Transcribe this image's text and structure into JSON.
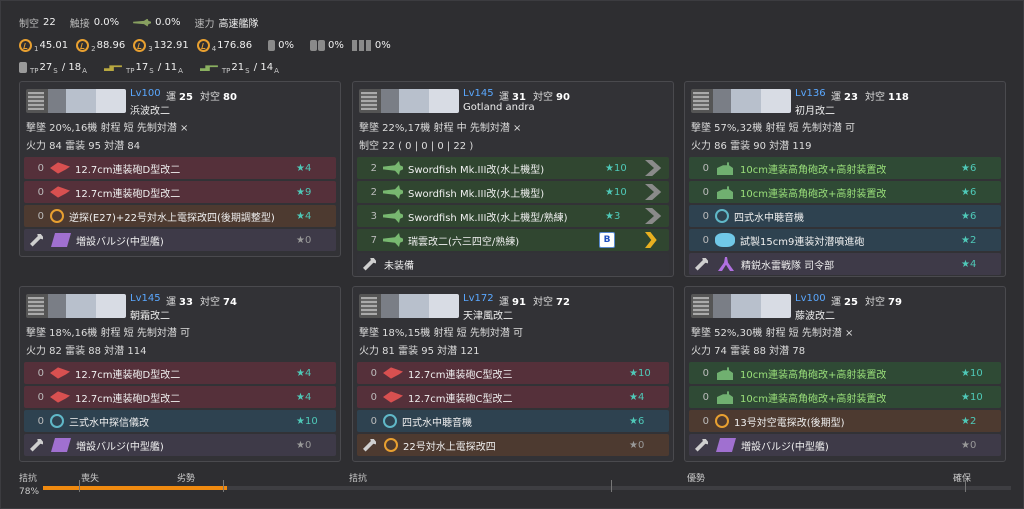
{
  "summary": {
    "air_label": "制空",
    "air_value": "22",
    "contact_label": "触接",
    "contact_value": "0.0%",
    "contact2_value": "0.0%",
    "speed_label": "速力",
    "speed_value": "高速艦隊",
    "los": [
      {
        "sub": "1",
        "value": "45.01"
      },
      {
        "sub": "2",
        "value": "88.96"
      },
      {
        "sub": "3",
        "value": "132.91"
      },
      {
        "sub": "4",
        "value": "176.86"
      }
    ],
    "drum_value": "0%",
    "drum2_value": "0%",
    "drum3_value": "0%",
    "tp": [
      {
        "value": "27",
        "s": "S",
        "sep": " / ",
        "a_value": "18",
        "a": "A",
        "prefix": "TP"
      },
      {
        "value": "17",
        "s": "S",
        "sep": " / ",
        "a_value": "11",
        "a": "A",
        "prefix": "TP"
      },
      {
        "value": "21",
        "s": "S",
        "sep": " / ",
        "a_value": "14",
        "a": "A",
        "prefix": "TP"
      }
    ]
  },
  "ships": [
    {
      "lv": "Lv100",
      "luck_label": "運",
      "luck": "25",
      "aa_label": "対空",
      "aa": "80",
      "name": "浜波改二",
      "line1": "撃墜 20%,16機  射程 短  先制対潜 ×",
      "line2": "火力 84  雷装 95  対潜 84",
      "line3": "",
      "equip": [
        {
          "slot": "0",
          "icon": "gun",
          "name": "12.7cm連装砲D型改二",
          "star": "★4",
          "color": "red"
        },
        {
          "slot": "0",
          "icon": "gun",
          "name": "12.7cm連装砲D型改二",
          "star": "★9",
          "color": "red"
        },
        {
          "slot": "0",
          "icon": "radar",
          "name": "逆探(E27)+22号対水上電探改四(後期調整型)",
          "star": "★4",
          "color": "brown"
        },
        {
          "slot": "",
          "icon": "bulge",
          "name": "増設バルジ(中型艦)",
          "star": "★0",
          "color": "purple"
        }
      ]
    },
    {
      "lv": "Lv145",
      "luck_label": "運",
      "luck": "31",
      "aa_label": "対空",
      "aa": "90",
      "name": "Gotland andra",
      "line1": "撃墜 22%,17機  射程 中  先制対潜 ×",
      "line2": "制空 22 ( 0 | 0 | 0 | 22 )",
      "line3": "",
      "equip": [
        {
          "slot": "2",
          "icon": "plane",
          "name": "Swordfish Mk.III改(水上機型)",
          "star": "★10",
          "color": "dkgreen",
          "prof": "gr"
        },
        {
          "slot": "2",
          "icon": "plane",
          "name": "Swordfish Mk.III改(水上機型)",
          "star": "★10",
          "color": "dkgreen",
          "prof": "gr"
        },
        {
          "slot": "3",
          "icon": "plane",
          "name": "Swordfish Mk.III改(水上機型/熟練)",
          "star": "★3",
          "color": "dkgreen",
          "prof": "gr"
        },
        {
          "slot": "7",
          "icon": "plane",
          "name": "瑞雲改二(六三四空/熟練)",
          "star": "B",
          "color": "dkgreen",
          "prof": "gold"
        },
        {
          "slot": "",
          "icon": "wrench",
          "name": "未装備",
          "star": "",
          "color": "gray"
        }
      ]
    },
    {
      "lv": "Lv136",
      "luck_label": "運",
      "luck": "23",
      "aa_label": "対空",
      "aa": "118",
      "name": "初月改二",
      "line1": "撃墜 57%,32機  射程 短  先制対潜 可",
      "line2": "火力 86  雷装 90  対潜 119",
      "line3": "",
      "equip": [
        {
          "slot": "0",
          "icon": "gun-g",
          "name": "10cm連装高角砲改+高射装置改",
          "star": "★6",
          "color": "green"
        },
        {
          "slot": "0",
          "icon": "gun-g",
          "name": "10cm連装高角砲改+高射装置改",
          "star": "★6",
          "color": "green"
        },
        {
          "slot": "0",
          "icon": "sonar",
          "name": "四式水中聴音機",
          "star": "★6",
          "color": "blue"
        },
        {
          "slot": "0",
          "icon": "dc",
          "name": "試製15cm9連装対潜噴進砲",
          "star": "★2",
          "color": "blue"
        },
        {
          "slot": "",
          "icon": "crew",
          "name": "精鋭水雷戦隊 司令部",
          "star": "★4",
          "color": "purple"
        }
      ]
    },
    {
      "lv": "Lv145",
      "luck_label": "運",
      "luck": "33",
      "aa_label": "対空",
      "aa": "74",
      "name": "朝霜改二",
      "line1": "撃墜 18%,16機  射程 短  先制対潜 可",
      "line2": "火力 82  雷装 88  対潜 114",
      "line3": "",
      "equip": [
        {
          "slot": "0",
          "icon": "gun",
          "name": "12.7cm連装砲D型改二",
          "star": "★4",
          "color": "red"
        },
        {
          "slot": "0",
          "icon": "gun",
          "name": "12.7cm連装砲D型改二",
          "star": "★4",
          "color": "red"
        },
        {
          "slot": "0",
          "icon": "sonar",
          "name": "三式水中探信儀改",
          "star": "★10",
          "color": "blue"
        },
        {
          "slot": "",
          "icon": "bulge",
          "name": "増設バルジ(中型艦)",
          "star": "★0",
          "color": "purple"
        }
      ]
    },
    {
      "lv": "Lv172",
      "luck_label": "運",
      "luck": "91",
      "aa_label": "対空",
      "aa": "72",
      "name": "天津風改二",
      "line1": "撃墜 18%,15機  射程 短  先制対潜 可",
      "line2": "火力 81  雷装 95  対潜 121",
      "line3": "",
      "equip": [
        {
          "slot": "0",
          "icon": "gun",
          "name": "12.7cm連装砲C型改三",
          "star": "★10",
          "color": "red"
        },
        {
          "slot": "0",
          "icon": "gun",
          "name": "12.7cm連装砲C型改二",
          "star": "★4",
          "color": "red"
        },
        {
          "slot": "0",
          "icon": "sonar",
          "name": "四式水中聴音機",
          "star": "★6",
          "color": "blue"
        },
        {
          "slot": "",
          "icon": "radar",
          "name": "22号対水上電探改四",
          "star": "★0",
          "color": "brown"
        }
      ]
    },
    {
      "lv": "Lv100",
      "luck_label": "運",
      "luck": "25",
      "aa_label": "対空",
      "aa": "79",
      "name": "藤波改二",
      "line1": "撃墜 52%,30機  射程 短  先制対潜 ×",
      "line2": "火力 74  雷装 88  対潜 78",
      "line3": "",
      "equip": [
        {
          "slot": "0",
          "icon": "gun-g",
          "name": "10cm連装高角砲改+高射装置改",
          "star": "★10",
          "color": "green"
        },
        {
          "slot": "0",
          "icon": "gun-g",
          "name": "10cm連装高角砲改+高射装置改",
          "star": "★10",
          "color": "green"
        },
        {
          "slot": "0",
          "icon": "radar",
          "name": "13号対空電探改(後期型)",
          "star": "★2",
          "color": "brown"
        },
        {
          "slot": "",
          "icon": "bulge",
          "name": "増設バルジ(中型艦)",
          "star": "★0",
          "color": "purple"
        }
      ]
    }
  ],
  "airbar": {
    "state": "拮抗",
    "percent": "78%",
    "fill_fraction": 0.19,
    "labels": [
      "喪失",
      "劣勢",
      "拮抗",
      "優勢",
      "確保"
    ]
  }
}
